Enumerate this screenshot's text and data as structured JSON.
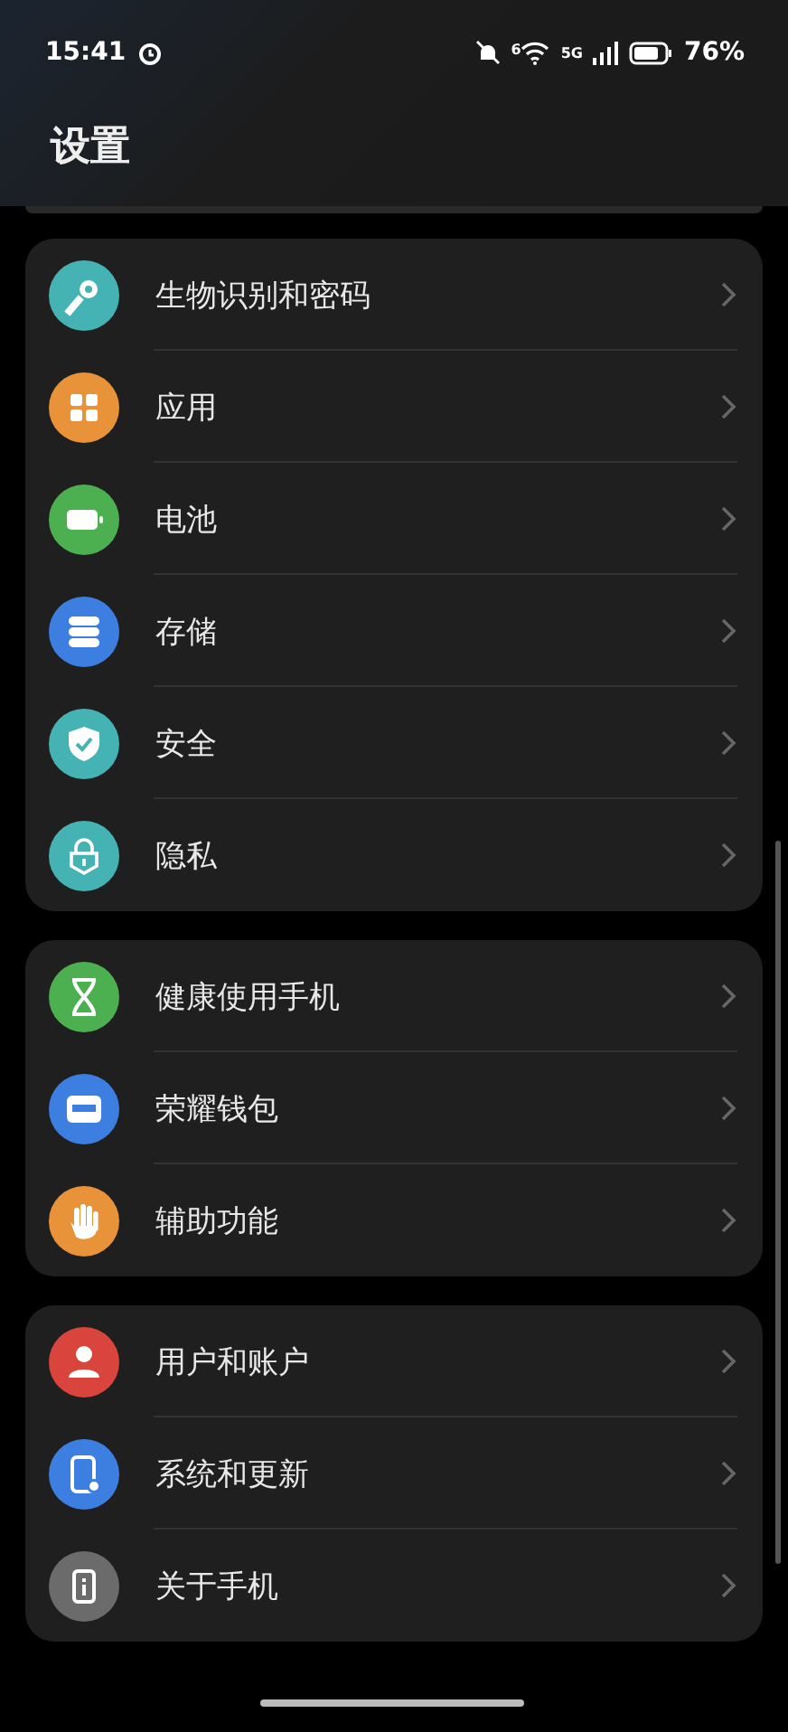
{
  "status_bar": {
    "time": "15:41",
    "battery": "76%",
    "network": "5G",
    "wifi_tag": "6"
  },
  "title": "设置",
  "groups": [
    {
      "items": [
        {
          "label": "生物识别和密码",
          "color": "#45b3b3"
        },
        {
          "label": "应用",
          "color": "#e8933a"
        },
        {
          "label": "电池",
          "color": "#4caf50"
        },
        {
          "label": "存储",
          "color": "#3d7fe0"
        },
        {
          "label": "安全",
          "color": "#45b3b3"
        },
        {
          "label": "隐私",
          "color": "#45b3b3"
        }
      ]
    },
    {
      "items": [
        {
          "label": "健康使用手机",
          "color": "#4caf50"
        },
        {
          "label": "荣耀钱包",
          "color": "#3d7fe0"
        },
        {
          "label": "辅助功能",
          "color": "#e8933a"
        }
      ]
    },
    {
      "items": [
        {
          "label": "用户和账户",
          "color": "#d9453d"
        },
        {
          "label": "系统和更新",
          "color": "#3d7fe0"
        },
        {
          "label": "关于手机",
          "color": "#6b6b6b"
        }
      ]
    }
  ]
}
